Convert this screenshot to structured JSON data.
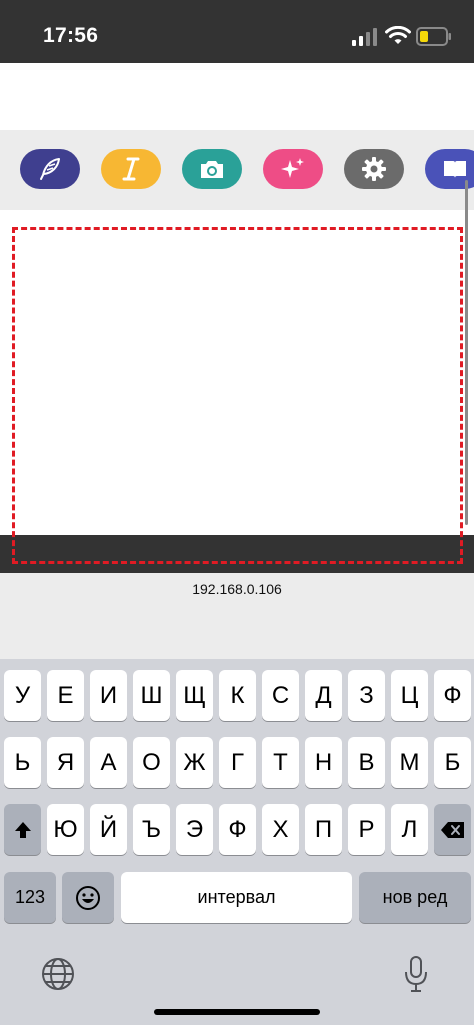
{
  "status_bar": {
    "time": "17:56"
  },
  "toolbar": {
    "tools": [
      {
        "name": "feather",
        "color": "#3f3f8f"
      },
      {
        "name": "text-cursor",
        "color": "#f7b733"
      },
      {
        "name": "camera",
        "color": "#2aa198"
      },
      {
        "name": "sparkles",
        "color": "#ee4d86"
      },
      {
        "name": "gear",
        "color": "#6b6b6b"
      },
      {
        "name": "book",
        "color": "#4a52b8"
      }
    ]
  },
  "connection": {
    "ip": "192.168.0.106"
  },
  "keyboard": {
    "row1": [
      "У",
      "Е",
      "И",
      "Ш",
      "Щ",
      "К",
      "С",
      "Д",
      "З",
      "Ц"
    ],
    "row2": [
      "Ь",
      "Я",
      "А",
      "О",
      "Ж",
      "Г",
      "Т",
      "Н",
      "В",
      "М"
    ],
    "row3": [
      "Ю",
      "Й",
      "Ъ",
      "Э",
      "Ф",
      "Х",
      "П",
      "Р",
      "Л"
    ],
    "numbers_label": "123",
    "space_label": "интервал",
    "return_label": "нов ред"
  }
}
